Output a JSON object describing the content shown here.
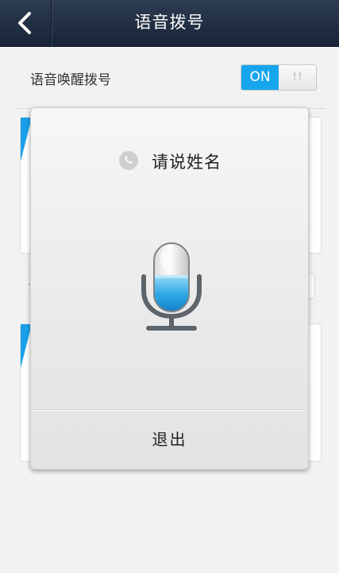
{
  "header": {
    "title": "语音拨号",
    "back_icon": "chevron-left-icon"
  },
  "setting": {
    "label": "语音唤醒拨号",
    "toggle_on_text": "ON",
    "toggle_knob_text": "!!",
    "enabled": true
  },
  "dialog": {
    "prompt": "请说姓名",
    "prompt_icon": "phone-bubble-icon",
    "mic_icon": "microphone-icon",
    "exit_label": "退出"
  },
  "colors": {
    "accent": "#17a6ee",
    "header_bg": "#1f2c40"
  }
}
